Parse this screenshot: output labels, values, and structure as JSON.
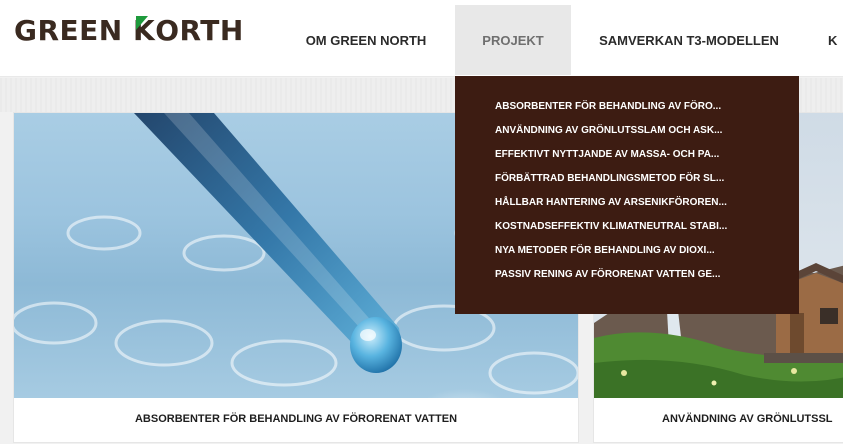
{
  "brand": {
    "logo_text_before": "GREEN ",
    "logo_text_k": "K",
    "logo_text_after": "ORTH"
  },
  "nav": {
    "items": [
      {
        "label": "OM GREEN NORTH"
      },
      {
        "label": "PROJEKT"
      },
      {
        "label": "SAMVERKAN T3-MODELLEN"
      },
      {
        "label": "K"
      }
    ]
  },
  "dropdown": {
    "items": [
      "ABSORBENTER FÖR BEHANDLING AV FÖRO...",
      "ANVÄNDNING AV GRÖNLUTSSLAM OCH ASK...",
      "EFFEKTIVT NYTTJANDE AV MASSA- OCH PA...",
      "FÖRBÄTTRAD BEHANDLINGSMETOD FÖR SL...",
      "HÅLLBAR HANTERING AV ARSENIKFÖROREN...",
      "KOSTNADSEFFEKTIV KLIMATNEUTRAL STABI...",
      "NYA METODER FÖR BEHANDLING AV DIOXI...",
      "PASSIV RENING AV FÖRORENAT VATTEN GE..."
    ]
  },
  "cards": [
    {
      "caption": "ABSORBENTER FÖR BEHANDLING AV FÖRORENAT VATTEN"
    },
    {
      "caption": "ANVÄNDNING AV GRÖNLUTSSL"
    }
  ],
  "colors": {
    "brand_dark": "#3a2a20",
    "brand_green": "#1e9a3c",
    "dropdown_bg": "#3d1c12",
    "active_nav_bg": "#e8e8e8"
  }
}
